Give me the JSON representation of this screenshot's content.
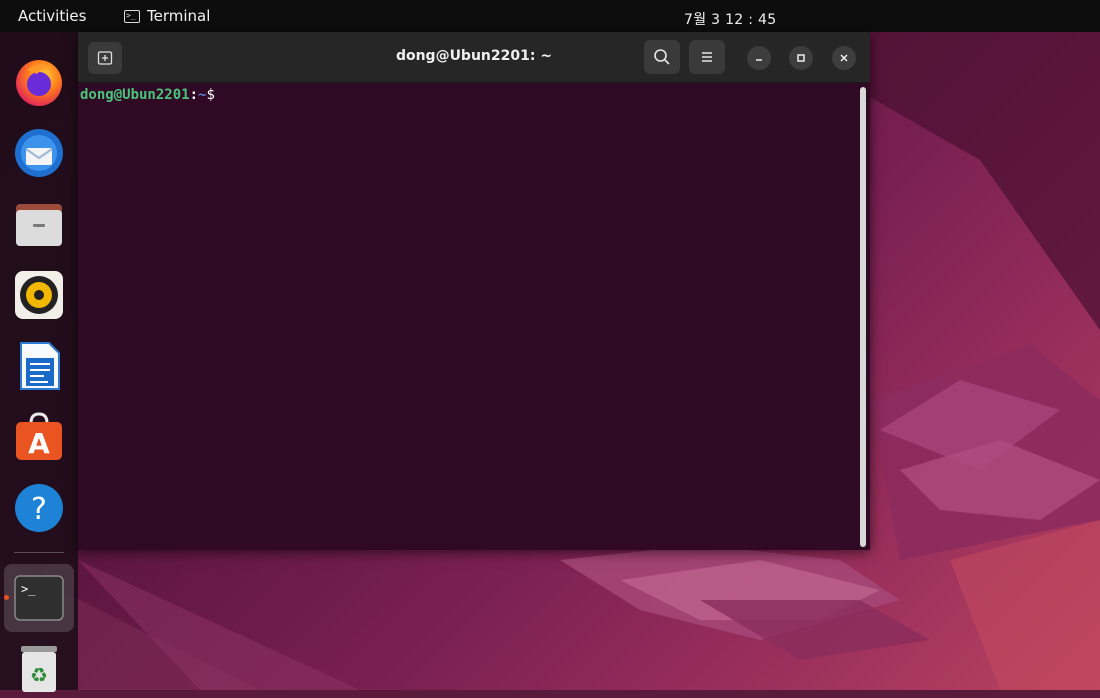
{
  "topbar": {
    "activities_label": "Activities",
    "app_name": "Terminal",
    "clock": "7월 3 12 : 45"
  },
  "dock": {
    "items": [
      {
        "name": "Firefox",
        "icon": "firefox-icon"
      },
      {
        "name": "Thunderbird",
        "icon": "thunderbird-icon"
      },
      {
        "name": "Files",
        "icon": "files-icon"
      },
      {
        "name": "Rhythmbox",
        "icon": "rhythmbox-icon"
      },
      {
        "name": "LibreOffice Writer",
        "icon": "writer-icon"
      },
      {
        "name": "Ubuntu Software",
        "icon": "software-icon"
      },
      {
        "name": "Help",
        "icon": "help-icon"
      },
      {
        "name": "Terminal",
        "icon": "terminal-icon",
        "running": true
      },
      {
        "name": "Trash",
        "icon": "trash-icon"
      }
    ]
  },
  "terminal": {
    "title": "dong@Ubun2201: ~",
    "prompt": {
      "user_host": "dong@Ubun2201",
      "separator": ":",
      "path": "~",
      "symbol": "$"
    }
  },
  "colors": {
    "topbar": "#0d0d0d",
    "terminal_bg": "#300a24",
    "prompt_user": "#4ac47c",
    "prompt_path": "#5c7fd1",
    "accent": "#e95420"
  }
}
